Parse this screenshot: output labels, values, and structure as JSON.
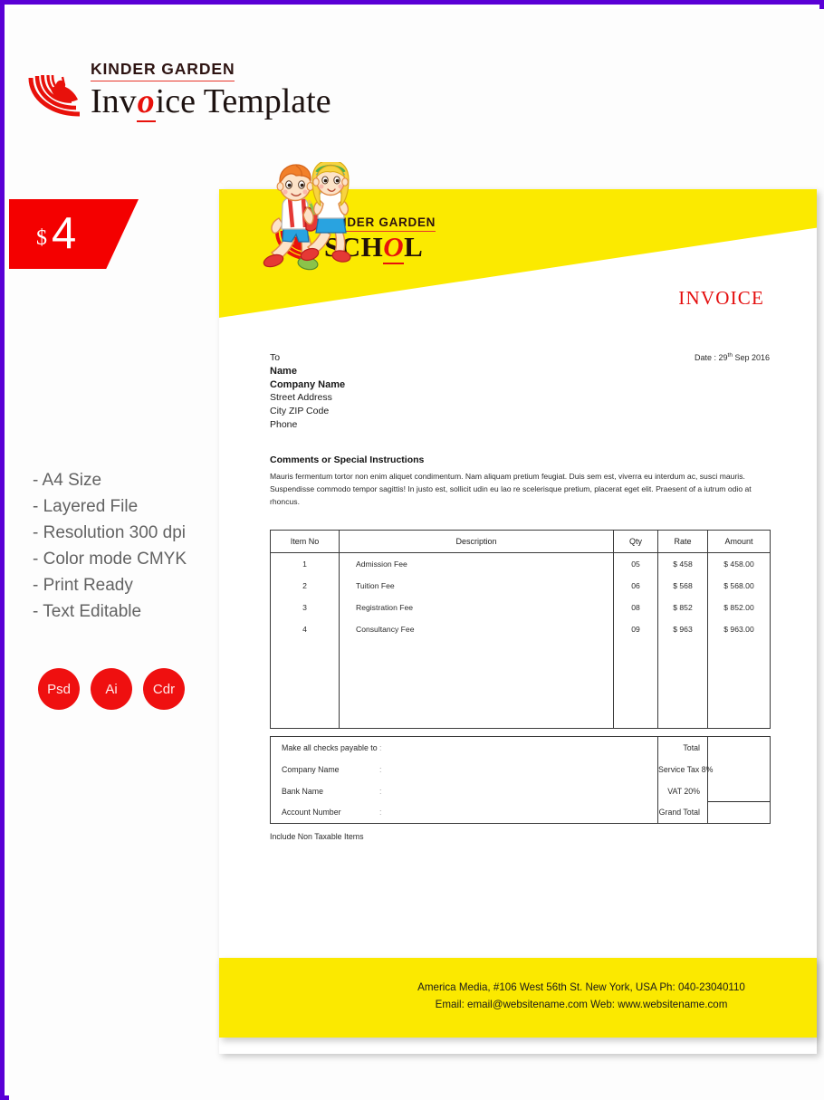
{
  "masthead": {
    "kicker": "KINDER GARDEN",
    "title_pre": "Inv",
    "title_accent": "o",
    "title_post": "ice Template",
    "logo_icon": "spiral-swoosh-icon"
  },
  "price_badge": {
    "currency": "$",
    "amount": "4"
  },
  "features": [
    "- A4 Size",
    "- Layered File",
    "- Resolution 300 dpi",
    "- Color mode CMYK",
    "- Print Ready",
    "- Text Editable"
  ],
  "format_badges": [
    "Psd",
    "Ai",
    "Cdr"
  ],
  "sheet": {
    "banner": {
      "kicker": "KINDER GARDEN",
      "school_pre": "SCH",
      "school_accent": "O",
      "school_post": "L",
      "logo_icon": "spiral-swoosh-icon"
    },
    "invoice_label": "INVOICE",
    "bill_to": {
      "to": "To",
      "name": "Name",
      "company": "Company Name",
      "street": "Street Address",
      "city_zip": "City ZIP Code",
      "phone": "Phone"
    },
    "date": {
      "prefix": "Date : 29",
      "suffix": "th",
      "rest": " Sep 2016"
    },
    "comments": {
      "heading": "Comments or Special Instructions",
      "body": "Mauris fermentum tortor non enim aliquet condimentum. Nam aliquam pretium feugiat. Duis sem est, viverra eu interdum ac, susci mauris. Suspendisse commodo tempor sagittis! In justo est, sollicit udin eu  lao re scelerisque pretium, placerat eget elit. Praesent of a iutrum odio at rhoncus."
    },
    "table": {
      "headers": [
        "Item No",
        "Description",
        "Qty",
        "Rate",
        "Amount"
      ],
      "rows": [
        {
          "item": "1",
          "desc": "Admission Fee",
          "qty": "05",
          "rate": "$ 458",
          "amount": "$ 458.00"
        },
        {
          "item": "2",
          "desc": "Tuition Fee",
          "qty": "06",
          "rate": "$ 568",
          "amount": "$ 568.00"
        },
        {
          "item": "3",
          "desc": "Registration Fee",
          "qty": "08",
          "rate": "$ 852",
          "amount": "$ 852.00"
        },
        {
          "item": "4",
          "desc": "Consultancy Fee",
          "qty": "09",
          "rate": "$ 963",
          "amount": "$ 963.00"
        }
      ]
    },
    "totals": {
      "payment_labels": [
        "Make all checks payable to",
        "Company Name",
        "Bank Name",
        "Account Number"
      ],
      "colon": ":",
      "rows": [
        {
          "label": "Total",
          "value": ""
        },
        {
          "label": "Service Tax 8%",
          "value": ""
        },
        {
          "label": "VAT 20%",
          "value": ""
        },
        {
          "label": "Grand Total",
          "value": ""
        }
      ]
    },
    "non_taxable_note": "Include Non Taxable Items",
    "footer": {
      "line1": "America Media, #106 West 56th St. New York, USA Ph: 040-23040110",
      "line2": "Email: email@websitename.com Web: www.websitename.com",
      "kids_icon": "two-school-children-icon"
    }
  },
  "colors": {
    "frame": "#5a00d6",
    "red": "#ef1010",
    "yellow": "#fbea00",
    "invoice_red": "#e40d0d",
    "feature_gray": "#636363"
  }
}
